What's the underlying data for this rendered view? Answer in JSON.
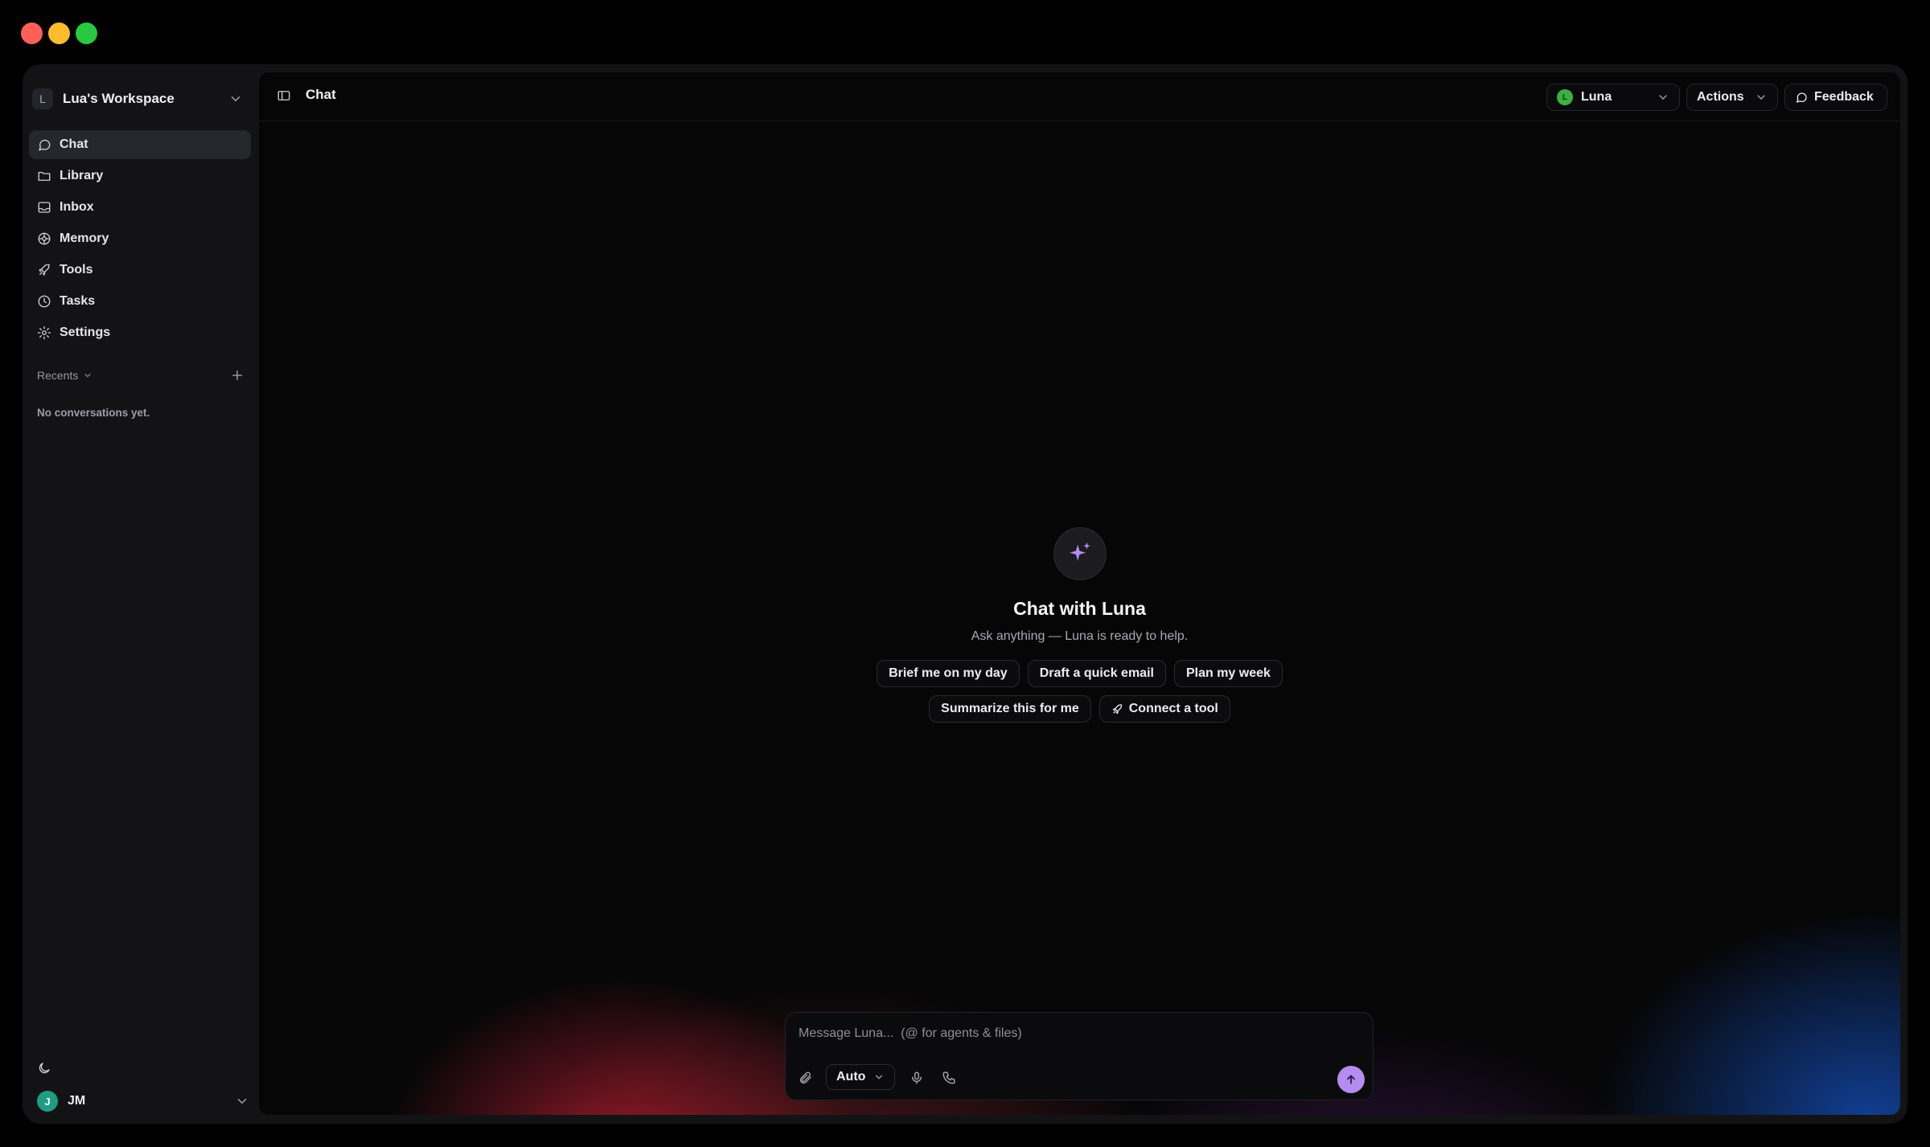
{
  "sidebar": {
    "workspace": {
      "avatar": "L",
      "name": "Lua's Workspace"
    },
    "items": [
      {
        "label": "Chat",
        "icon": "chat-icon",
        "active": true
      },
      {
        "label": "Library",
        "icon": "folder-icon"
      },
      {
        "label": "Inbox",
        "icon": "inbox-icon"
      },
      {
        "label": "Memory",
        "icon": "memory-icon"
      },
      {
        "label": "Tools",
        "icon": "rocket-icon"
      },
      {
        "label": "Tasks",
        "icon": "clock-icon"
      },
      {
        "label": "Settings",
        "icon": "gear-icon"
      }
    ],
    "recents_label": "Recents",
    "empty_text": "No conversations yet.",
    "user": {
      "avatar": "J",
      "name": "JM"
    }
  },
  "header": {
    "title": "Chat",
    "agent": {
      "avatar": "L",
      "name": "Luna"
    },
    "actions_label": "Actions",
    "feedback_label": "Feedback"
  },
  "hero": {
    "title": "Chat with Luna",
    "subtitle": "Ask anything — Luna is ready to help.",
    "suggestions_row1": [
      "Brief me on my day",
      "Draft a quick email",
      "Plan my week"
    ],
    "suggestions_row2": [
      "Summarize this for me",
      "Connect a tool"
    ]
  },
  "composer": {
    "placeholder": "Message Luna...  (@ for agents & files)",
    "mode": "Auto"
  },
  "colors": {
    "accent": "#b58cf0",
    "agent_dot": "#3cb043",
    "user_avatar": "#1f9d82"
  }
}
